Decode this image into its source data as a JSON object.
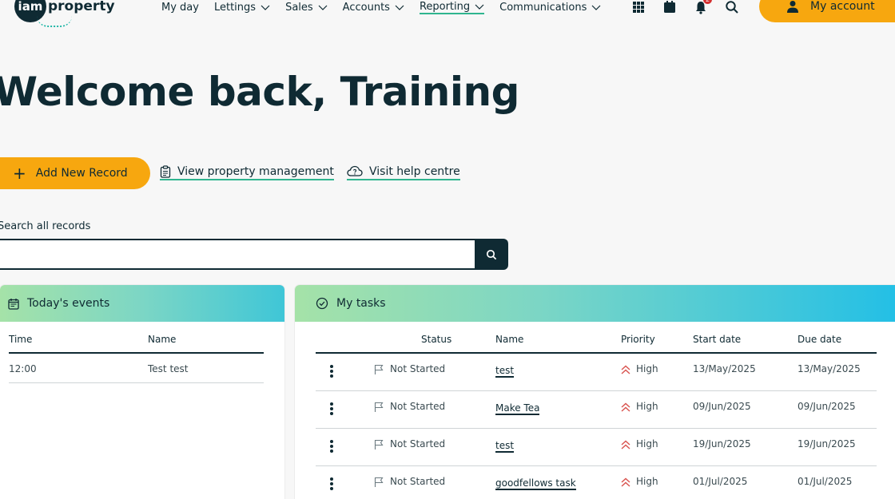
{
  "app": {
    "logo_prefix": "iam",
    "logo_text": "property"
  },
  "nav": {
    "items": [
      {
        "label": "My day",
        "dropdown": false,
        "active": false
      },
      {
        "label": "Lettings",
        "dropdown": true,
        "active": false
      },
      {
        "label": "Sales",
        "dropdown": true,
        "active": false
      },
      {
        "label": "Accounts",
        "dropdown": true,
        "active": false
      },
      {
        "label": "Reporting",
        "dropdown": true,
        "active": true
      },
      {
        "label": "Communications",
        "dropdown": true,
        "active": false
      }
    ],
    "icons": [
      "apps-grid-icon",
      "calendar-icon",
      "bell-icon",
      "search-icon"
    ],
    "notification_count": "2",
    "account_label": "My account"
  },
  "welcome": "Welcome back, Training",
  "actions": {
    "add_record": "Add New Record",
    "view_property_management": "View property management",
    "visit_help_centre": "Visit help centre"
  },
  "search": {
    "label": "Search all records",
    "value": ""
  },
  "events": {
    "title": "Today's events",
    "columns": [
      "Time",
      "Name"
    ],
    "rows": [
      {
        "time": "12:00",
        "name": "Test test"
      }
    ]
  },
  "tasks": {
    "title": "My tasks",
    "columns": [
      "Status",
      "Name",
      "Priority",
      "Start date",
      "Due date"
    ],
    "rows": [
      {
        "status": "Not Started",
        "name": "test",
        "priority": "High",
        "start": "13/May/2025",
        "due": "13/May/2025"
      },
      {
        "status": "Not Started",
        "name": "Make Tea",
        "priority": "High",
        "start": "09/Jun/2025",
        "due": "09/Jun/2025"
      },
      {
        "status": "Not Started",
        "name": "test",
        "priority": "High",
        "start": "19/Jun/2025",
        "due": "19/Jun/2025"
      },
      {
        "status": "Not Started",
        "name": "goodfellows task",
        "priority": "High",
        "start": "01/Jul/2025",
        "due": "01/Jul/2025"
      }
    ]
  },
  "colors": {
    "primary": "#0f2a33",
    "accent": "#f7a70f",
    "link_underline": "#2fb58f",
    "priority_high": "#d9534f"
  }
}
